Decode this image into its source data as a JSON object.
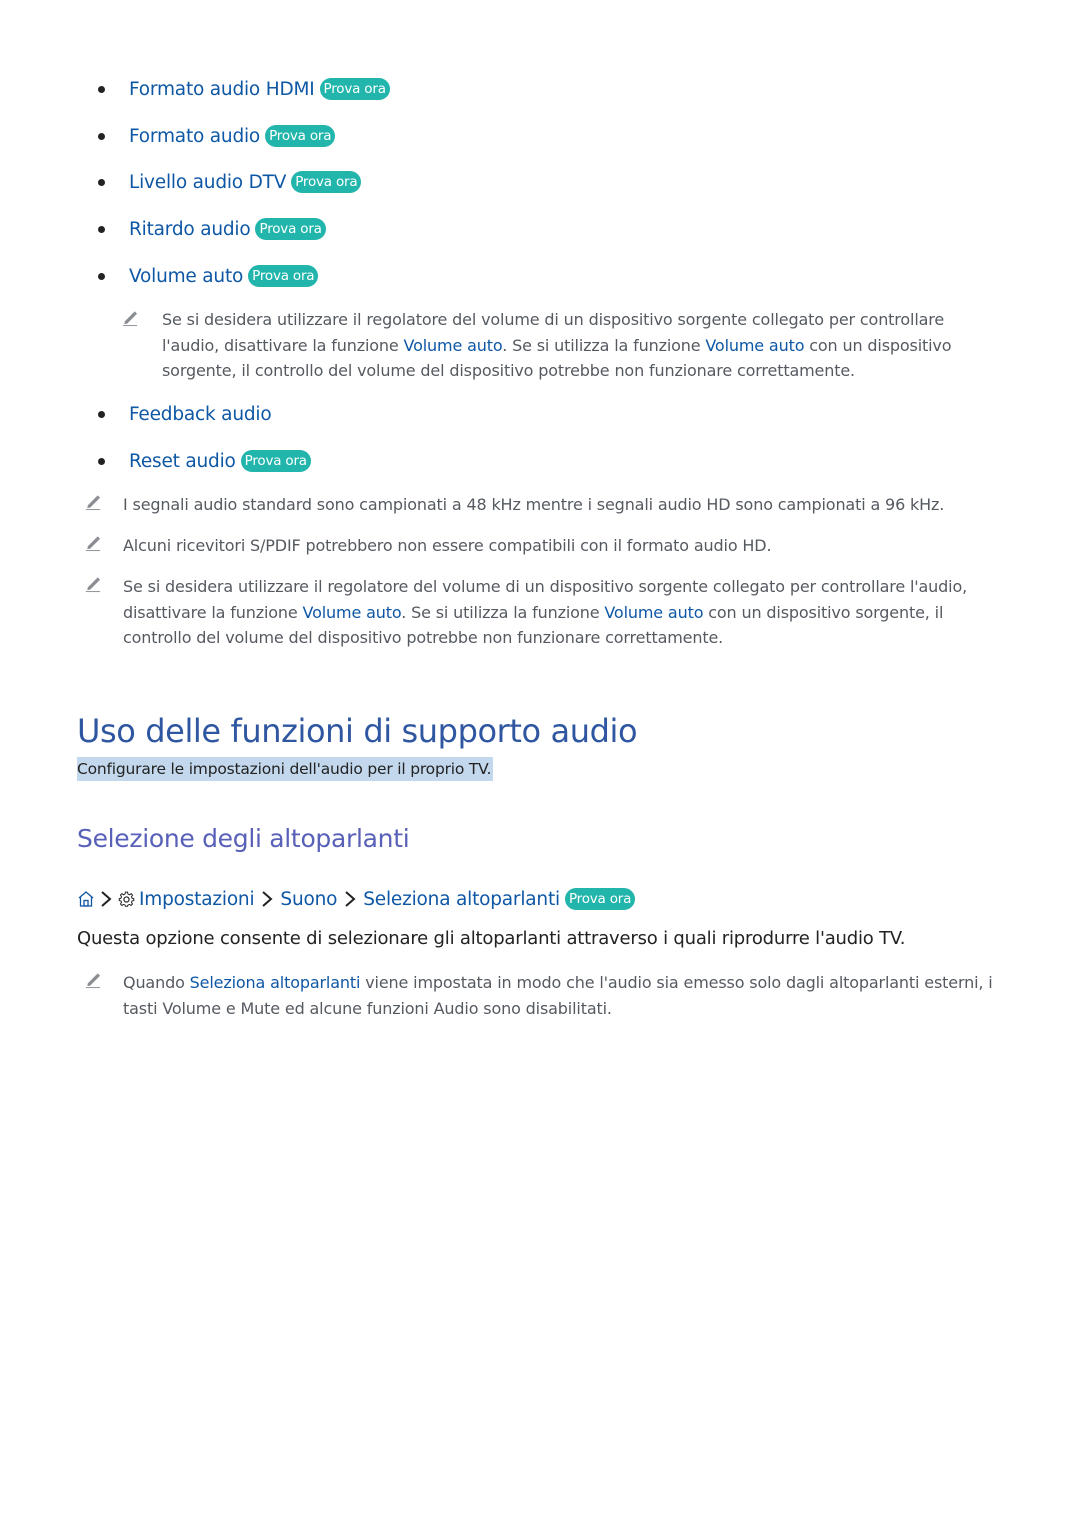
{
  "badge_label": "Prova ora",
  "colors": {
    "link": "#0e57a5",
    "badge": "#22b5ac",
    "heading1": "#2f56a0",
    "heading2": "#5860b8",
    "highlight": "#c3d8ec",
    "note_text": "#555a61"
  },
  "menu_items": [
    {
      "label": "Formato audio HDMI",
      "has_badge": true
    },
    {
      "label": "Formato audio",
      "has_badge": true
    },
    {
      "label": "Livello audio DTV",
      "has_badge": true
    },
    {
      "label": "Ritardo audio",
      "has_badge": true
    },
    {
      "label": "Volume auto",
      "has_badge": true
    },
    {
      "label": "Feedback audio",
      "has_badge": false
    },
    {
      "label": "Reset audio",
      "has_badge": true
    }
  ],
  "volume_auto_note": {
    "part1": "Se si desidera utilizzare il regolatore del volume di un dispositivo sorgente collegato per controllare l'audio, disattivare la funzione ",
    "link1": "Volume auto",
    "part2": ". Se si utilizza la funzione ",
    "link2": "Volume auto",
    "part3": " con un dispositivo sorgente, il controllo del volume del dispositivo potrebbe non funzionare correttamente."
  },
  "notes": [
    {
      "text": "I segnali audio standard sono campionati a 48 kHz mentre i segnali audio HD sono campionati a 96 kHz."
    },
    {
      "text": "Alcuni ricevitori S/PDIF potrebbero non essere compatibili con il formato audio HD."
    },
    {
      "part1": "Se si desidera utilizzare il regolatore del volume di un dispositivo sorgente collegato per controllare l'audio, disattivare la funzione ",
      "link1": "Volume auto",
      "part2": ". Se si utilizza la funzione ",
      "link2": "Volume auto",
      "part3": " con un dispositivo sorgente, il controllo del volume del dispositivo potrebbe non funzionare correttamente."
    }
  ],
  "section": {
    "title": "Uso delle funzioni di supporto audio",
    "subtitle": "Configurare le impostazioni dell'audio per il proprio TV."
  },
  "subsection": {
    "title": "Selezione degli altoparlanti",
    "breadcrumb": {
      "home_icon": "home-icon",
      "settings_icon": "gear-icon",
      "items": [
        "Impostazioni",
        "Suono",
        "Seleziona altoparlanti"
      ]
    },
    "description": "Questa opzione consente di selezionare gli altoparlanti attraverso i quali riprodurre l'audio TV.",
    "note": {
      "part1": "Quando ",
      "link": "Seleziona altoparlanti",
      "part2": " viene impostata in modo che l'audio sia emesso solo dagli altoparlanti esterni, i tasti Volume e Mute ed alcune funzioni Audio sono disabilitati."
    }
  }
}
